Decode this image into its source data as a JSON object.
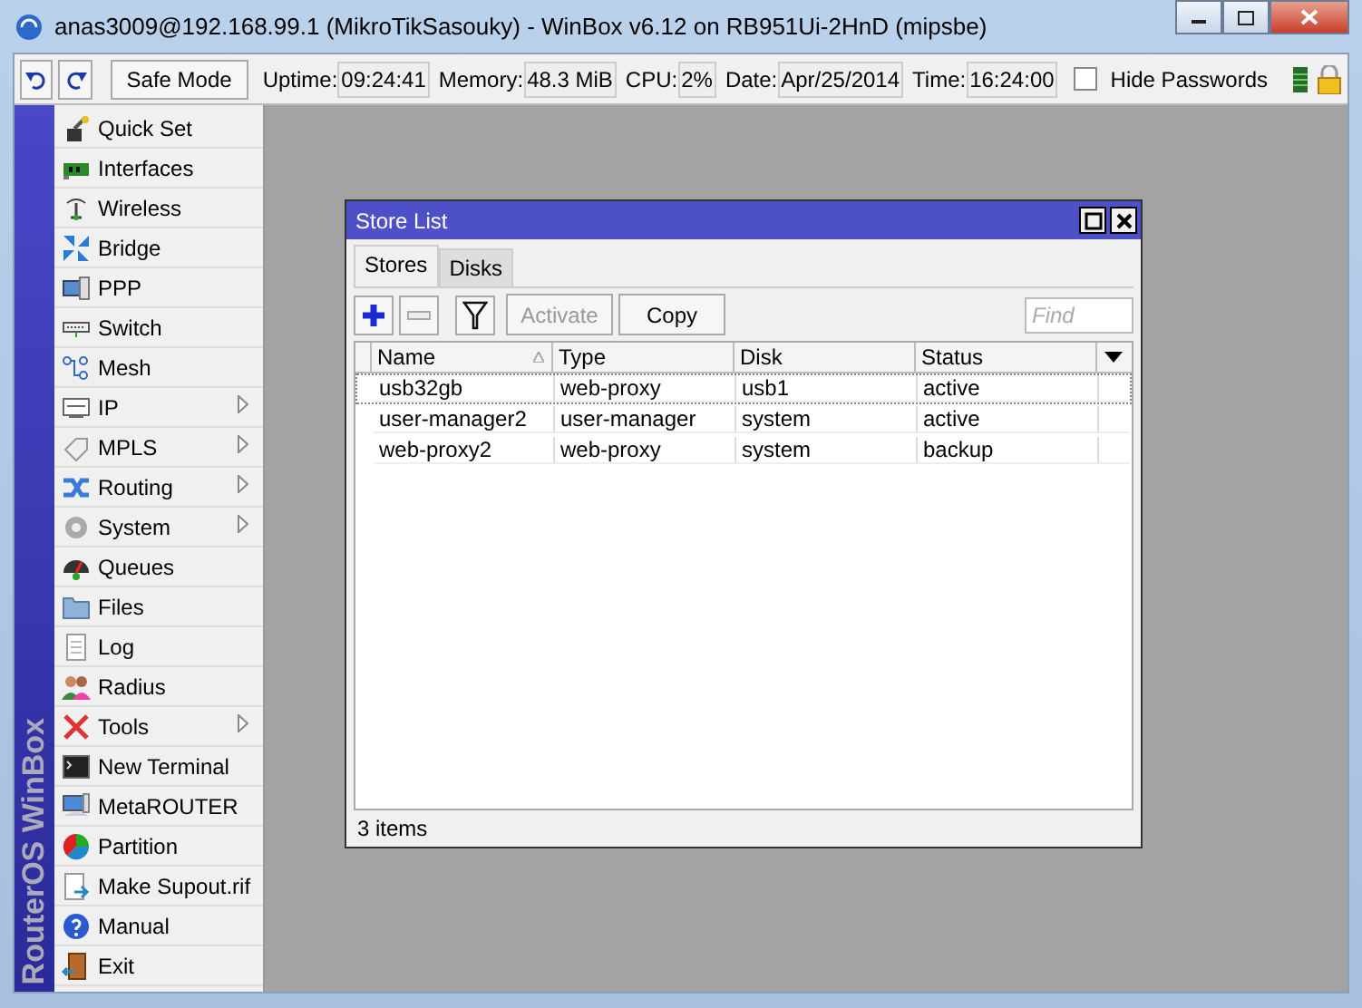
{
  "window": {
    "title": "anas3009@192.168.99.1 (MikroTikSasouky) - WinBox v6.12 on RB951Ui-2HnD (mipsbe)"
  },
  "toolbar": {
    "safe_mode": "Safe Mode",
    "fields": [
      {
        "label": "Uptime:",
        "value": "09:24:41"
      },
      {
        "label": "Memory:",
        "value": "48.3 MiB"
      },
      {
        "label": "CPU:",
        "value": "2%"
      },
      {
        "label": "Date:",
        "value": "Apr/25/2014"
      },
      {
        "label": "Time:",
        "value": "16:24:00"
      }
    ],
    "hide_passwords": {
      "label": "Hide Passwords",
      "checked": false
    }
  },
  "sidebar": {
    "brand": "RouterOS WinBox",
    "items": [
      {
        "label": "Quick Set",
        "submenu": false
      },
      {
        "label": "Interfaces",
        "submenu": false
      },
      {
        "label": "Wireless",
        "submenu": false
      },
      {
        "label": "Bridge",
        "submenu": false
      },
      {
        "label": "PPP",
        "submenu": false
      },
      {
        "label": "Switch",
        "submenu": false
      },
      {
        "label": "Mesh",
        "submenu": false
      },
      {
        "label": "IP",
        "submenu": true
      },
      {
        "label": "MPLS",
        "submenu": true
      },
      {
        "label": "Routing",
        "submenu": true
      },
      {
        "label": "System",
        "submenu": true
      },
      {
        "label": "Queues",
        "submenu": false
      },
      {
        "label": "Files",
        "submenu": false
      },
      {
        "label": "Log",
        "submenu": false
      },
      {
        "label": "Radius",
        "submenu": false
      },
      {
        "label": "Tools",
        "submenu": true
      },
      {
        "label": "New Terminal",
        "submenu": false
      },
      {
        "label": "MetaROUTER",
        "submenu": false
      },
      {
        "label": "Partition",
        "submenu": false
      },
      {
        "label": "Make Supout.rif",
        "submenu": false
      },
      {
        "label": "Manual",
        "submenu": false
      },
      {
        "label": "Exit",
        "submenu": false
      }
    ]
  },
  "store_list": {
    "title": "Store List",
    "tabs": [
      {
        "label": "Stores",
        "selected": true
      },
      {
        "label": "Disks",
        "selected": false
      }
    ],
    "buttons": [
      {
        "label": "Activate",
        "disabled": true
      },
      {
        "label": "Copy",
        "disabled": false
      }
    ],
    "remove_disabled": true,
    "find": {
      "placeholder": "Find"
    },
    "columns": [
      {
        "label": "Name",
        "sorted": true
      },
      {
        "label": "Type",
        "sorted": false
      },
      {
        "label": "Disk",
        "sorted": false
      },
      {
        "label": "Status",
        "sorted": false
      }
    ],
    "rows": [
      {
        "cells": [
          "usb32gb",
          "web-proxy",
          "usb1",
          "active"
        ],
        "focused": true
      },
      {
        "cells": [
          "user-manager2",
          "user-manager",
          "system",
          "active"
        ],
        "focused": false
      },
      {
        "cells": [
          "web-proxy2",
          "web-proxy",
          "system",
          "backup"
        ],
        "focused": false
      }
    ],
    "status": "3 items"
  }
}
